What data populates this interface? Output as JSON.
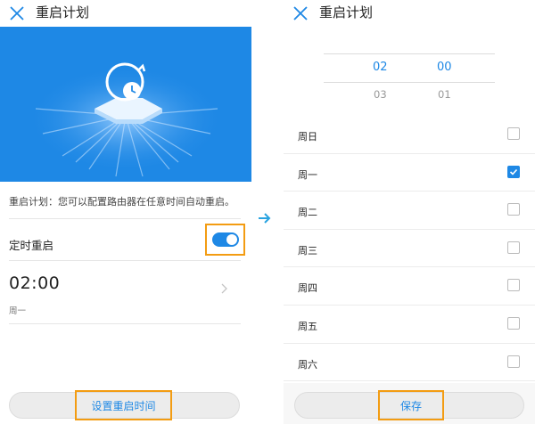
{
  "left": {
    "title": "重启计划",
    "description": "重启计划：您可以配置路由器在任意时间自动重启。",
    "timer_label": "定时重启",
    "timer_enabled": true,
    "time": "02:00",
    "days_summary": "周一",
    "set_button": "设置重启时间"
  },
  "right": {
    "title": "重启计划",
    "picker": {
      "hour_selected": "02",
      "minute_selected": "00",
      "hour_next": "03",
      "minute_next": "01"
    },
    "days": [
      {
        "label": "周日",
        "checked": false
      },
      {
        "label": "周一",
        "checked": true
      },
      {
        "label": "周二",
        "checked": false
      },
      {
        "label": "周三",
        "checked": false
      },
      {
        "label": "周四",
        "checked": false
      },
      {
        "label": "周五",
        "checked": false
      },
      {
        "label": "周六",
        "checked": false
      }
    ],
    "save_button": "保存"
  },
  "colors": {
    "accent": "#1e88e5",
    "highlight": "#f39c12",
    "arrow": "#29a3e0"
  }
}
